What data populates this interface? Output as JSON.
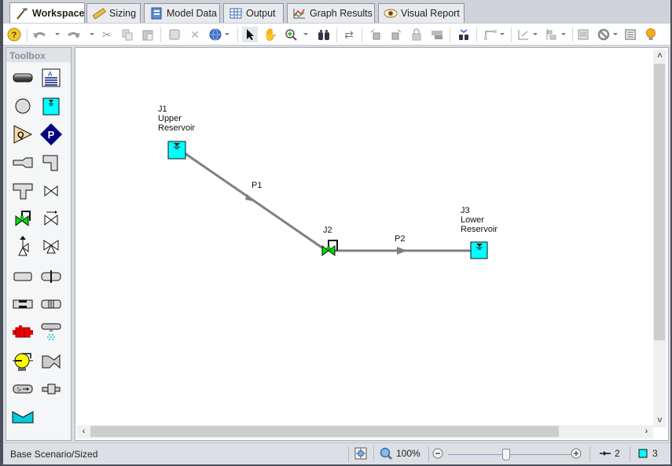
{
  "tabs": [
    {
      "label": "Workspace",
      "icon": "hammer-icon",
      "active": true
    },
    {
      "label": "Sizing",
      "icon": "ruler-icon",
      "active": false
    },
    {
      "label": "Model Data",
      "icon": "notebook-icon",
      "active": false
    },
    {
      "label": "Output",
      "icon": "table-icon",
      "active": false
    },
    {
      "label": "Graph Results",
      "icon": "graph-icon",
      "active": false
    },
    {
      "label": "Visual Report",
      "icon": "eye-icon",
      "active": false
    }
  ],
  "toolbar": {
    "buttons": [
      "help",
      "undo",
      "redo",
      "cut",
      "copy",
      "paste",
      "group",
      "delete",
      "globe",
      "select",
      "pan",
      "zoom-in",
      "find",
      "reverse",
      "rotate-left",
      "rotate-right",
      "lock",
      "annotation",
      "find-in-list",
      "pipe-style",
      "grid",
      "align",
      "properties-panel",
      "no-symbol",
      "list-view",
      "tips"
    ]
  },
  "toolbox": {
    "title": "Toolbox",
    "items": [
      "pipe",
      "annotation",
      "branch",
      "reservoir",
      "assigned-flow",
      "assigned-pressure",
      "area-change",
      "bend",
      "tee",
      "valve",
      "control-valve",
      "check-valve",
      "relief-valve",
      "three-way-valve",
      "spray-discharge",
      "orifice",
      "screen",
      "venturi",
      "heat-exchanger",
      "spray-nozzle",
      "pump",
      "general-component",
      "filter",
      "dead-end",
      "volume-balance"
    ]
  },
  "model": {
    "junctions": [
      {
        "id": "J1",
        "name_line1": "Upper",
        "name_line2": "Reservoir",
        "type": "reservoir"
      },
      {
        "id": "J2",
        "type": "control-valve"
      },
      {
        "id": "J3",
        "name_line1": "Lower",
        "name_line2": "Reservoir",
        "type": "reservoir"
      }
    ],
    "pipes": [
      {
        "id": "P1",
        "from": "J1",
        "to": "J2"
      },
      {
        "id": "P2",
        "from": "J2",
        "to": "J3"
      }
    ]
  },
  "status": {
    "scenario": "Base Scenario/Sized",
    "zoom": "100%",
    "zoom_slider_fraction": 0.5,
    "pipe_count": "2",
    "junction_count": "3"
  },
  "colors": {
    "reservoir_fill": "#00ffff",
    "valve_green": "#00cc00",
    "pipe_gray": "#808080"
  }
}
